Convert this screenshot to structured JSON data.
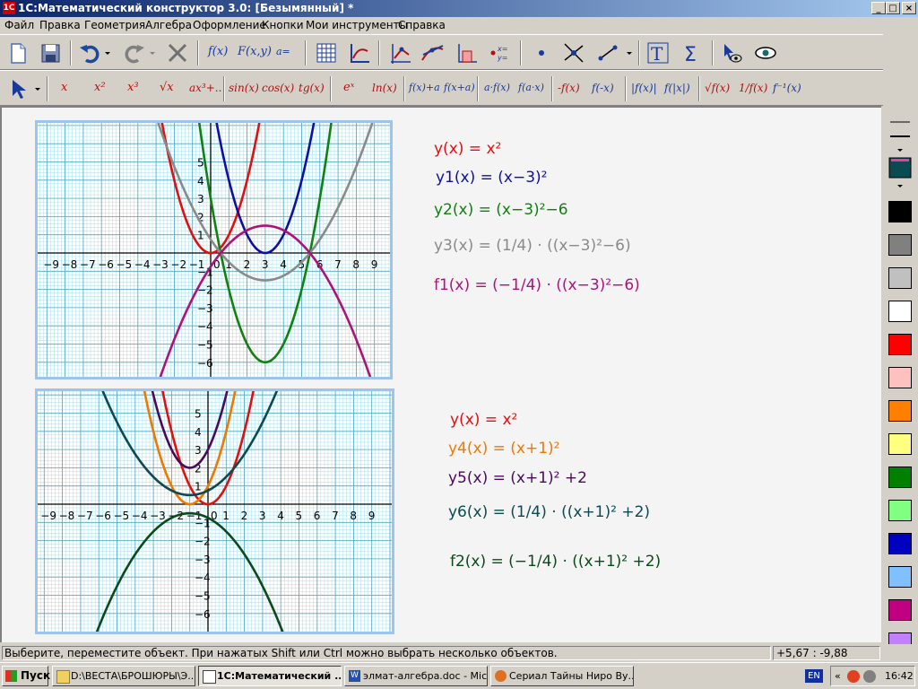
{
  "window": {
    "title": "1С:Математический конструктор 3.0: [Безымянный] *",
    "app_icon": "1C"
  },
  "menu": [
    "Файл",
    "Правка",
    "Геометрия",
    "Алгебра",
    "Оформление",
    "Кнопки",
    "Мои инструменты",
    "Справка"
  ],
  "toolbar1": {
    "fx": "f(x)",
    "fxy": "F(x,y)",
    "param": "a=",
    "xy_eq": "x=\ny="
  },
  "toolbar2": {
    "items": [
      "x",
      "x²",
      "x³",
      "√x",
      "ax³+..",
      "sin(x)",
      "cos(x)",
      "tg(x)",
      "eˣ",
      "ln(x)",
      "f(x)+a",
      "f(x+a)",
      "a·f(x)",
      "f(a·x)",
      "-f(x)",
      "f(-x)",
      "|f(x)|",
      "f(|x|)",
      "√f(x)",
      "1/f(x)",
      "f⁻¹(x)"
    ]
  },
  "graph_top": {
    "x_ticks": [
      "−9",
      "−8",
      "−7",
      "−6",
      "−5",
      "−4",
      "−3",
      "−2",
      "−1",
      "0",
      "1",
      "2",
      "3",
      "4",
      "5",
      "6",
      "7",
      "8",
      "9"
    ],
    "y_ticks": [
      "5",
      "4",
      "3",
      "2",
      "1",
      "−1",
      "−2",
      "−3",
      "−4",
      "−5",
      "−6"
    ],
    "colors": {
      "y": "#e01010",
      "y1": "#1010a0",
      "y2": "#108010",
      "y3": "#8a8a8a",
      "f1": "#b0107a"
    }
  },
  "graph_bottom": {
    "x_ticks": [
      "−9",
      "−8",
      "−7",
      "−6",
      "−5",
      "−4",
      "−3",
      "−2",
      "−1",
      "0",
      "1",
      "2",
      "3",
      "4",
      "5",
      "6",
      "7",
      "8",
      "9"
    ],
    "y_ticks": [
      "5",
      "4",
      "3",
      "2",
      "1",
      "−1",
      "−2",
      "−3",
      "−4",
      "−5",
      "−6"
    ],
    "colors": {
      "y": "#e01010",
      "y4": "#f07800",
      "y5": "#4a0a5a",
      "y6": "#0a4a50",
      "f2": "#0a4a1a"
    }
  },
  "formulas_top": [
    {
      "name": "y",
      "color": "#e01010",
      "text": "y(x) = x²"
    },
    {
      "name": "y1",
      "color": "#1010a0",
      "text": "y1(x) = (x−3)²"
    },
    {
      "name": "y2",
      "color": "#108010",
      "text": "y2(x) = (x−3)²−6"
    },
    {
      "name": "y3",
      "color": "#8a8a8a",
      "text": "y3(x) = (1/4) · ((x−3)²−6)"
    },
    {
      "name": "f1",
      "color": "#b0107a",
      "text": "f1(x) = (−1/4) · ((x−3)²−6)"
    }
  ],
  "formulas_bottom": [
    {
      "name": "y",
      "color": "#e01010",
      "text": "y(x) = x²"
    },
    {
      "name": "y4",
      "color": "#f07800",
      "text": "y4(x) = (x+1)²"
    },
    {
      "name": "y5",
      "color": "#4a0a5a",
      "text": "y5(x) = (x+1)² +2"
    },
    {
      "name": "y6",
      "color": "#0a4a50",
      "text": "y6(x) = (1/4) · ((x+1)² +2)"
    },
    {
      "name": "f2",
      "color": "#0a4a1a",
      "text": "f2(x) = (−1/4) · ((x+1)² +2)"
    }
  ],
  "palette": [
    "#000000",
    "#808080",
    "#c0c0c0",
    "#ffffff",
    "#ff0000",
    "#ffc0c0",
    "#ff8000",
    "#ffff80",
    "#008000",
    "#80ff80",
    "#0000c0",
    "#80c0ff",
    "#c00080",
    "#c080ff"
  ],
  "status": {
    "message": "Выберите, переместите объект. При нажатых Shift или Ctrl можно выбрать несколько объектов.",
    "coords": "+5,67 : -9,88"
  },
  "taskbar": {
    "start": "Пуск",
    "tasks": [
      {
        "label": "D:\\ВЕСТА\\БРОШЮРЫ\\Э...",
        "active": false
      },
      {
        "label": "1С:Математический ...",
        "active": true
      },
      {
        "label": "элмат-алгебра.doc - Mic...",
        "active": false
      },
      {
        "label": "Сериал Тайны Ниро Ву...",
        "active": false
      }
    ],
    "lang": "EN",
    "time": "16:42"
  }
}
